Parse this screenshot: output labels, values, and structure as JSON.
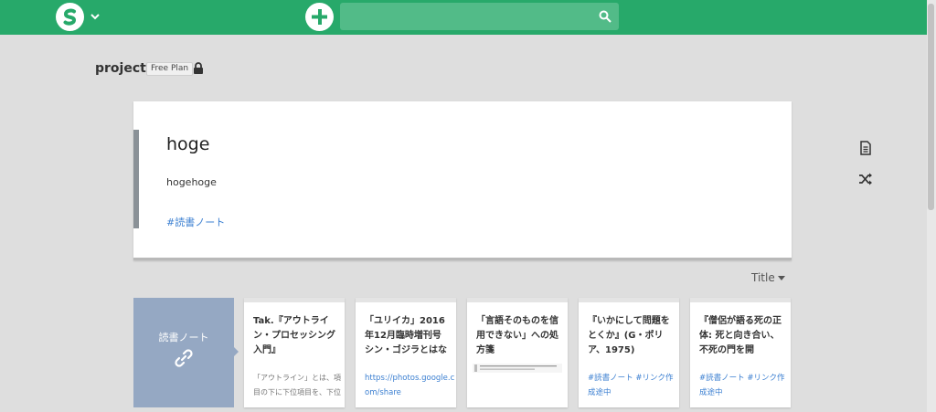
{
  "header": {
    "search_placeholder": "",
    "brand_color": "#27a96a",
    "search_bg": "#52bb88"
  },
  "project": {
    "name": "project",
    "plan": "Free Plan"
  },
  "page": {
    "title": "hoge",
    "body": "hogehoge",
    "tag": "#読書ノート",
    "link_color": "#3b7fd1"
  },
  "sort": {
    "label": "Title"
  },
  "link_card": {
    "label": "読書ノート",
    "color": "#95a8c3"
  },
  "cards": [
    {
      "title": "Tak.『アウトライン・プロセッシング入門』",
      "text": "「アウトライン」とは、項目の下に下位項目を、下位"
    },
    {
      "title": "「ユリイカ」2016年12月臨時増刊号 シン・ゴジラとはな",
      "link": "https://photos.google.com/share"
    },
    {
      "title": "「言語そのものを信用できない」への処方箋"
    },
    {
      "title": "『いかにして問題をとくか』(G・ポリア、1975)",
      "link": "#読書ノート #リンク作成途中"
    },
    {
      "title": "『僧侶が語る死の正体: 死と向き合い、不死の門を開",
      "link": "#読書ノート #リンク作成途中"
    }
  ]
}
